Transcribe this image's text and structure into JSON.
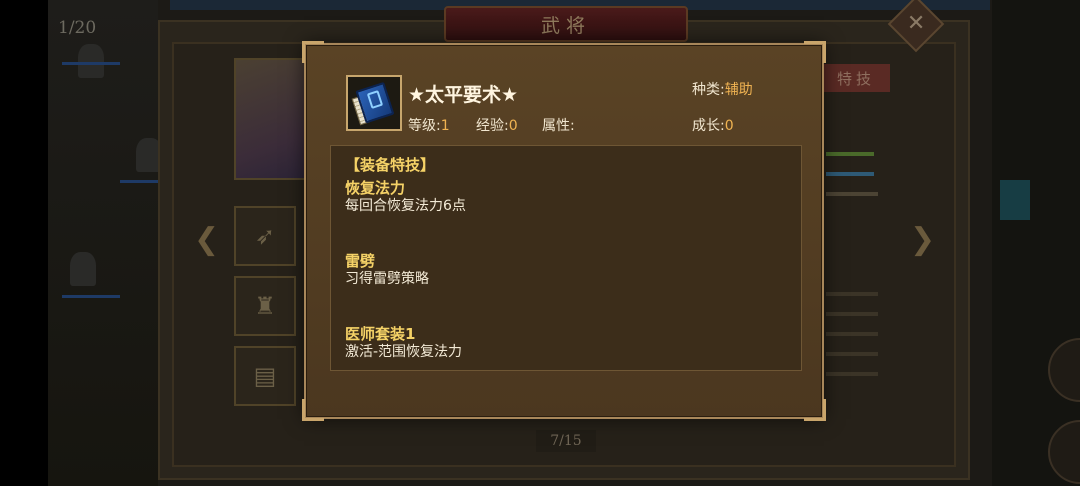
{
  "background": {
    "page_counter": "1/20",
    "title": "武将",
    "close_glyph": "✕",
    "skill_tab": "特技",
    "pager": "7/15"
  },
  "popup": {
    "item_icon": "blue-book-icon",
    "item_name": "★太平要术★",
    "type_label": "种类:",
    "type_value": "辅助",
    "level_label": "等级:",
    "level_value": "1",
    "exp_label": "经验:",
    "exp_value": "0",
    "attr_label": "属性:",
    "growth_label": "成长:",
    "growth_value": "0",
    "panel_title": "【装备特技】",
    "skills": [
      {
        "name": "恢复法力",
        "desc": "每回合恢复法力6点"
      },
      {
        "name": "雷劈",
        "desc": "习得雷劈策略"
      },
      {
        "name": "医师套装1",
        "desc": "激活-范围恢复法力"
      }
    ]
  },
  "colors": {
    "popup_bg": "#4b371f",
    "border_gold": "#c9a56b",
    "highlight_yellow": "#f5d267",
    "value_orange": "#f0b352"
  }
}
